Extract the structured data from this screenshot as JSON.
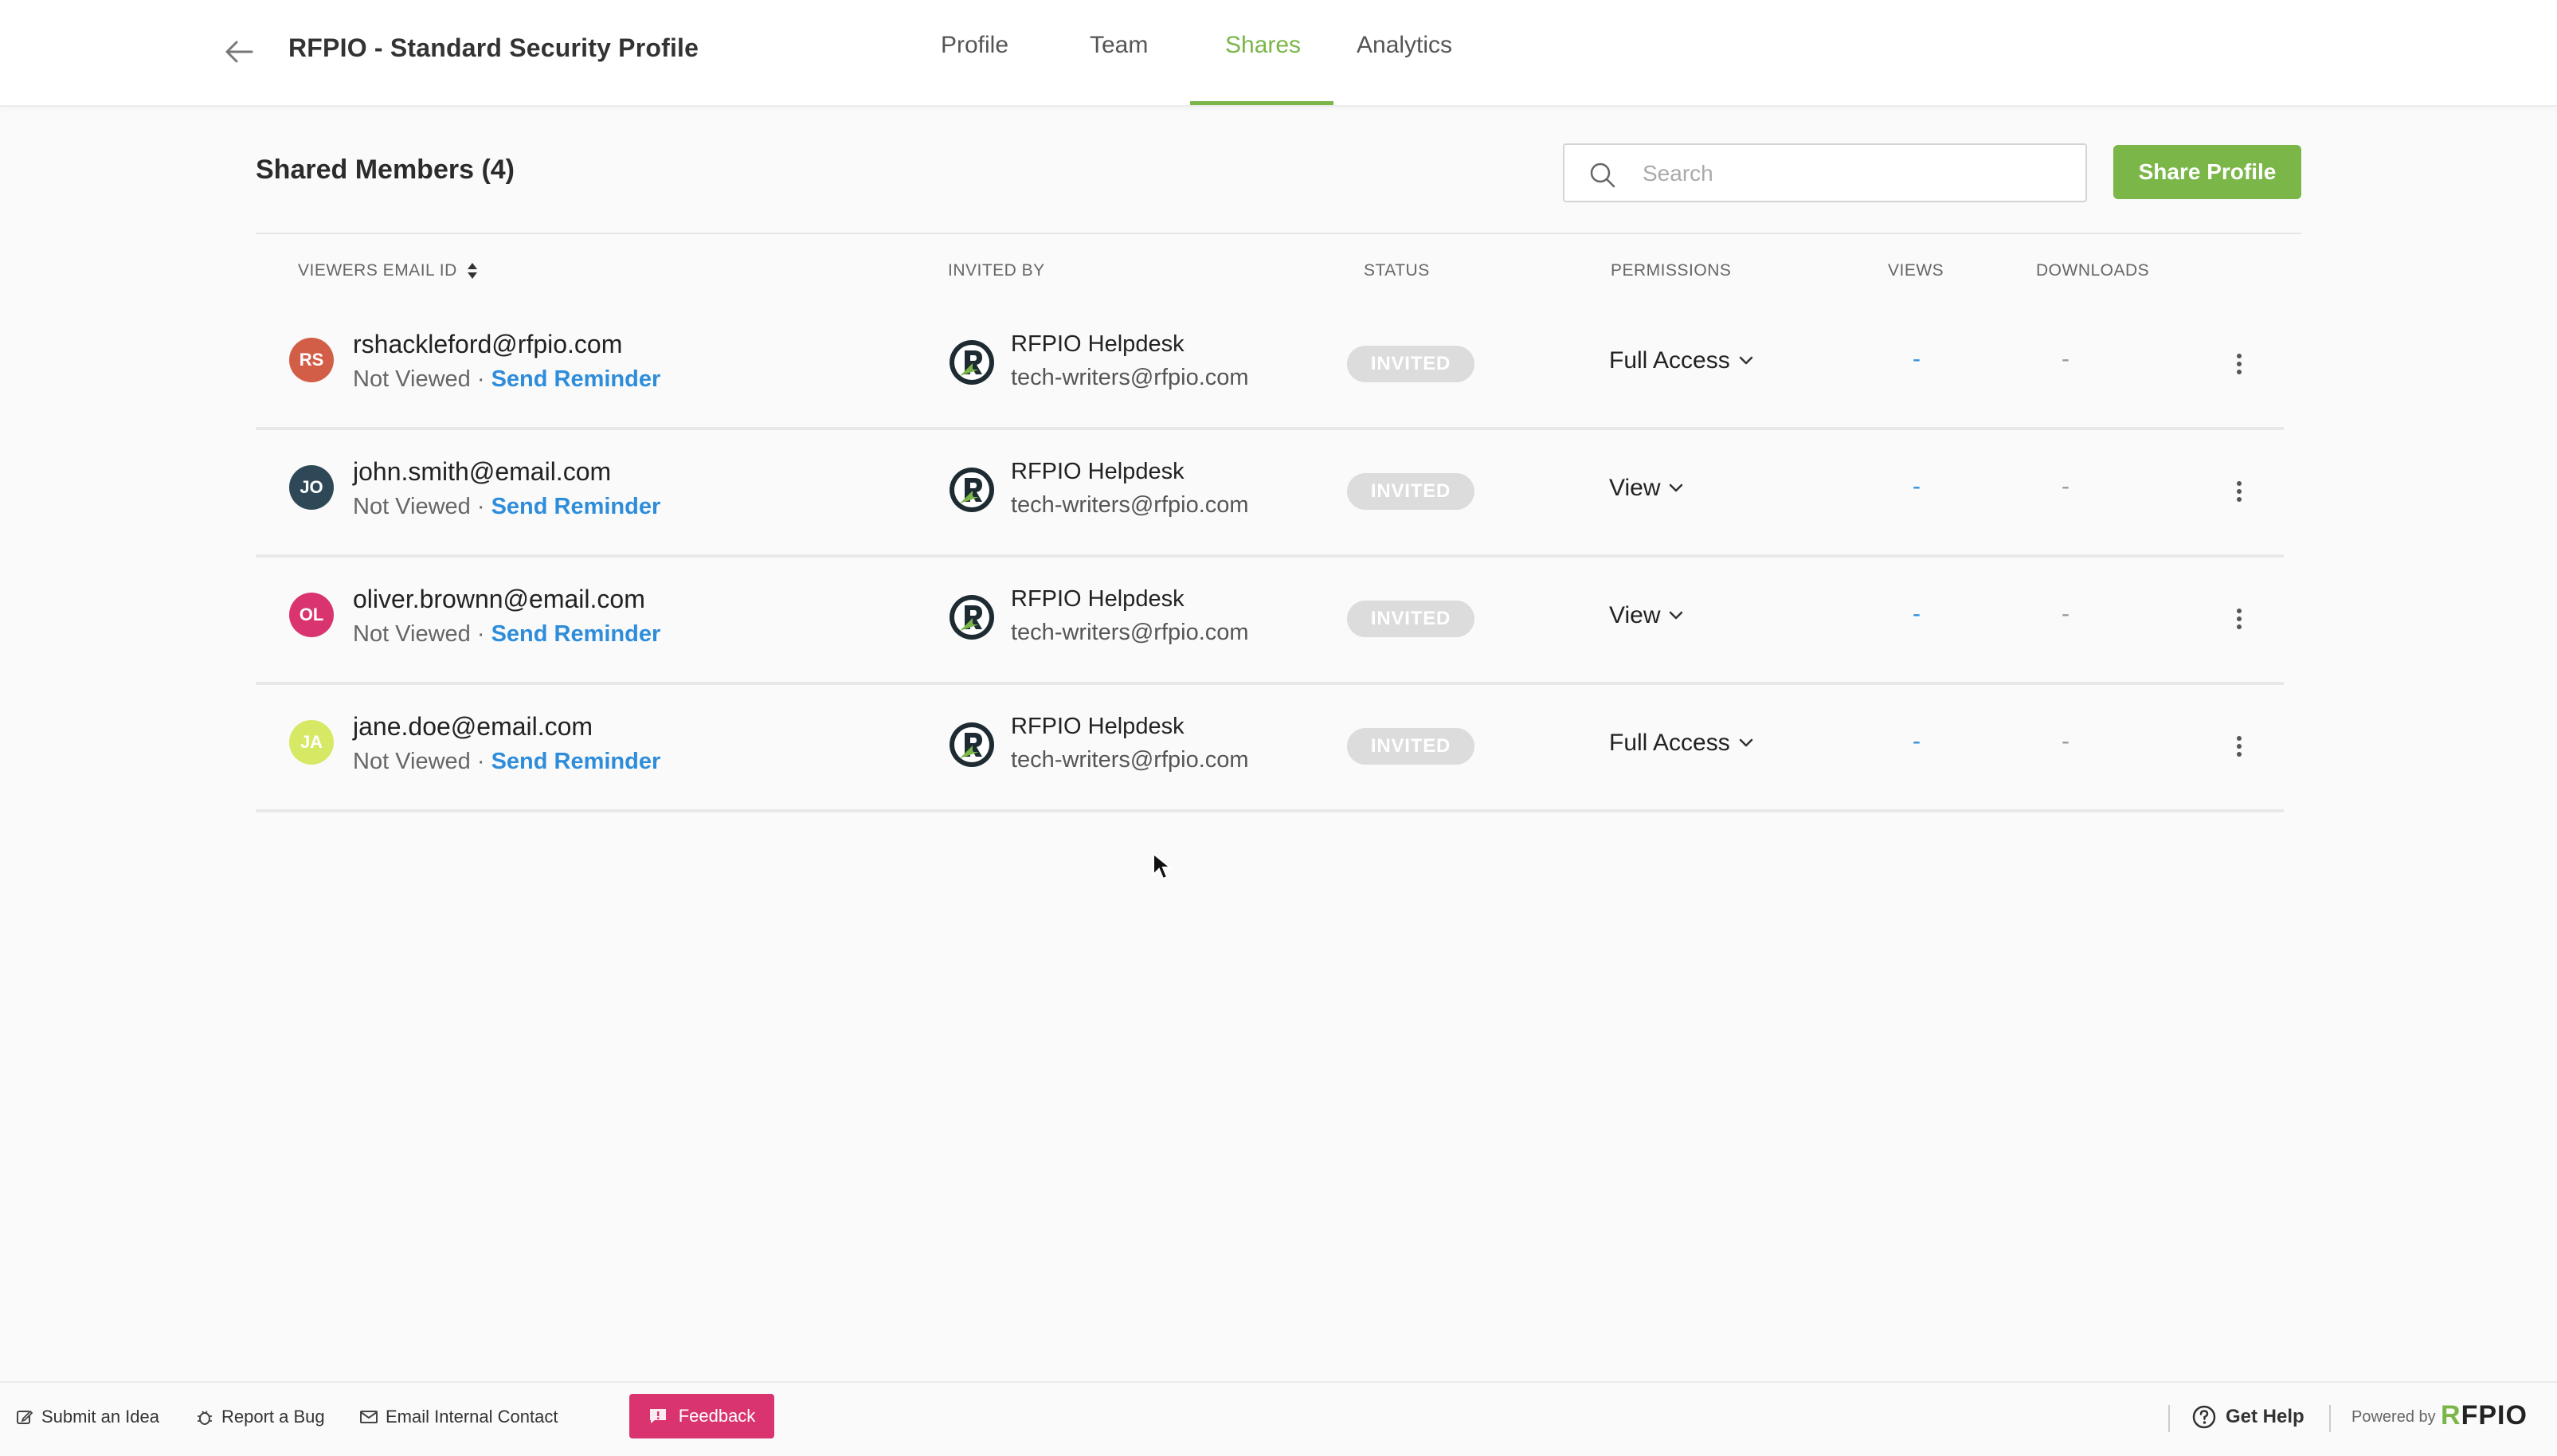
{
  "header": {
    "title": "RFPIO - Standard Security Profile",
    "tabs": [
      {
        "label": "Profile",
        "active": false
      },
      {
        "label": "Team",
        "active": false
      },
      {
        "label": "Shares",
        "active": true
      },
      {
        "label": "Analytics",
        "active": false
      }
    ],
    "accent_color": "#7ab648"
  },
  "section": {
    "title": "Shared Members (4)",
    "search_placeholder": "Search",
    "share_button": "Share Profile"
  },
  "table": {
    "columns": [
      "VIEWERS EMAIL ID",
      "INVITED BY",
      "STATUS",
      "PERMISSIONS",
      "VIEWS",
      "DOWNLOADS"
    ],
    "rows": [
      {
        "initials": "RS",
        "avatar_color": "#d35e47",
        "email": "rshackleford@rfpio.com",
        "view_status": "Not Viewed",
        "separator": " · ",
        "reminder": "Send Reminder",
        "inviter_name": "RFPIO Helpdesk",
        "inviter_email": "tech-writers@rfpio.com",
        "status": "INVITED",
        "permission": "Full Access",
        "views": "-",
        "downloads": "-"
      },
      {
        "initials": "JO",
        "avatar_color": "#2f4858",
        "email": "john.smith@email.com",
        "view_status": "Not Viewed",
        "separator": " · ",
        "reminder": "Send Reminder",
        "inviter_name": "RFPIO Helpdesk",
        "inviter_email": "tech-writers@rfpio.com",
        "status": "INVITED",
        "permission": "View",
        "views": "-",
        "downloads": "-"
      },
      {
        "initials": "OL",
        "avatar_color": "#d9346f",
        "email": "oliver.brownn@email.com",
        "view_status": "Not Viewed",
        "separator": " · ",
        "reminder": "Send Reminder",
        "inviter_name": "RFPIO Helpdesk",
        "inviter_email": "tech-writers@rfpio.com",
        "status": "INVITED",
        "permission": "View",
        "views": "-",
        "downloads": "-"
      },
      {
        "initials": "JA",
        "avatar_color": "#d7e865",
        "email": "jane.doe@email.com",
        "view_status": "Not Viewed",
        "separator": " · ",
        "reminder": "Send Reminder",
        "inviter_name": "RFPIO Helpdesk",
        "inviter_email": "tech-writers@rfpio.com",
        "status": "INVITED",
        "permission": "Full Access",
        "views": "-",
        "downloads": "-"
      }
    ]
  },
  "footer": {
    "submit_idea": "Submit an Idea",
    "report_bug": "Report a Bug",
    "email_contact": "Email Internal Contact",
    "feedback": "Feedback",
    "get_help": "Get Help",
    "powered_by": "Powered by",
    "brand_r": "R",
    "brand_rest": "FPIO",
    "feedback_color": "#d9346f"
  },
  "icons": [
    "back-arrow-icon",
    "search-icon",
    "sort-icon",
    "chevron-down-icon",
    "kebab-menu-icon",
    "rfpio-logo-icon",
    "edit-icon",
    "bug-icon",
    "mail-icon",
    "chat-icon",
    "help-circle-icon",
    "cursor-icon"
  ]
}
